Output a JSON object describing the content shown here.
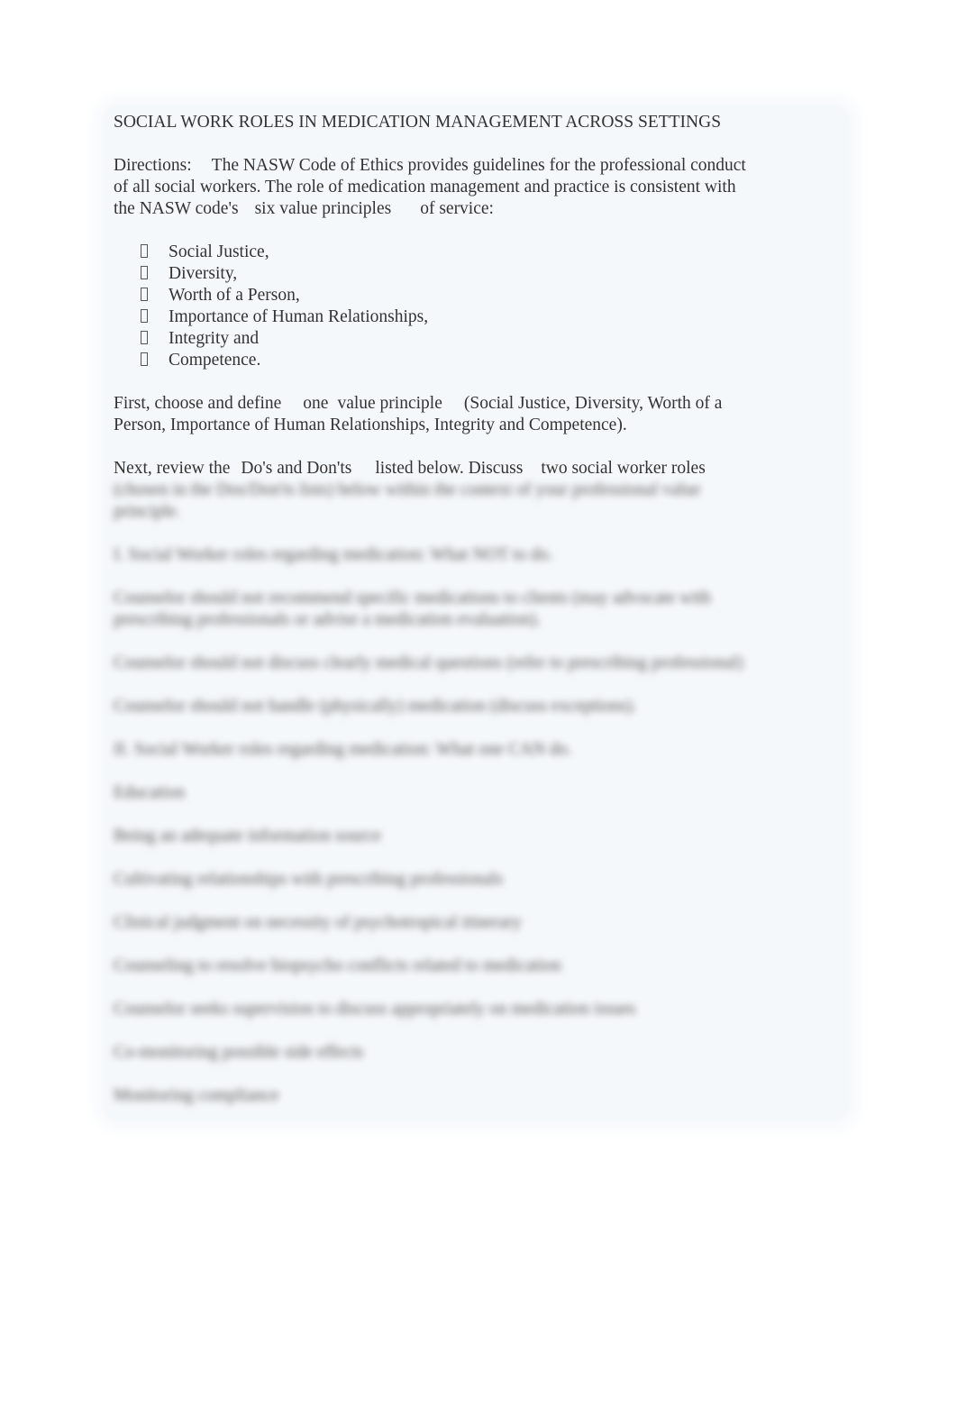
{
  "document": {
    "title": "SOCIAL WORK ROLES IN MEDICATION MANAGEMENT ACROSS SETTINGS",
    "directions": {
      "label": "Directions:",
      "line1": "The NASW Code of Ethics provides guidelines for the professional conduct",
      "line2": "of all social workers. The role of medication management and practice is consistent with",
      "line3_a": "the NASW code's",
      "line3_b": "six value principles",
      "line3_c": "of service:"
    },
    "value_principles": [
      {
        "bullet_icon": "missing-glyph-bullet",
        "label": "Social Justice,"
      },
      {
        "bullet_icon": "missing-glyph-bullet",
        "label": "Diversity,"
      },
      {
        "bullet_icon": "missing-glyph-bullet",
        "label": "Worth of a Person,"
      },
      {
        "bullet_icon": "missing-glyph-bullet",
        "label": "Importance of Human Relationships,"
      },
      {
        "bullet_icon": "missing-glyph-bullet",
        "label": "Integrity and"
      },
      {
        "bullet_icon": "missing-glyph-bullet",
        "label": "Competence."
      }
    ],
    "first_instruction": {
      "a": "First, choose and define",
      "b": "one",
      "c": "value principle",
      "d": "(Social Justice, Diversity, Worth of a",
      "line2": "Person, Importance of Human Relationships, Integrity and Competence)."
    },
    "next_instruction": {
      "a": "Next, review the",
      "b": "Do's and Don'ts",
      "c": "listed below. Discuss",
      "d": "two social worker roles"
    },
    "blurred_preview": {
      "continuation_line1": "(chosen in the Dos/Don'ts lists) below within the context of your professional value",
      "continuation_line2": "principle.",
      "section1_heading": "I. Social Worker roles regarding medication: What NOT to do.",
      "section1_items": [
        [
          "Counselor should not recommend specific medications to clients (may advocate with",
          "prescribing professionals or advise a medication evaluation)."
        ],
        [
          "Counselor should not discuss clearly medical questions (refer to prescribing professional)"
        ],
        [
          "Counselor should not handle (physically) medication (discuss exceptions)."
        ]
      ],
      "section2_heading": "II. Social Worker roles regarding medication: What one CAN do.",
      "section2_items": [
        "Education",
        "Being an adequate information source",
        "Cultivating relationships with prescribing professionals",
        "Clinical judgment on necessity of psychotropical itinerary",
        "Counseling to resolve biopsycho conflicts related to medication",
        "Counselor seeks supervision to discuss appropriately on medication issues",
        "Co-monitoring possible side effects",
        "Monitoring compliance"
      ]
    }
  }
}
